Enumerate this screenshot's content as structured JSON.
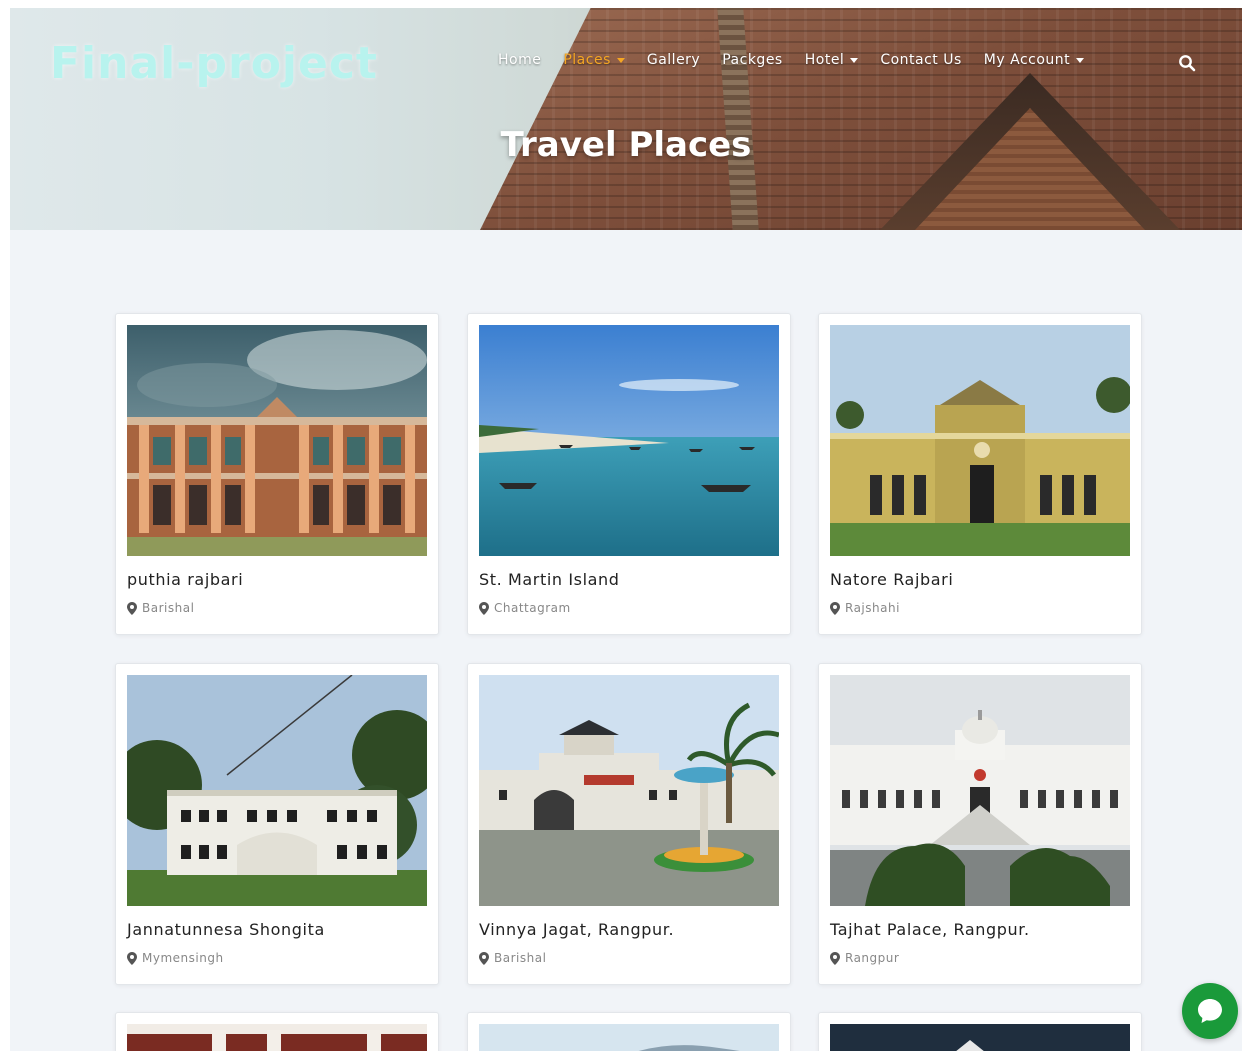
{
  "header": {
    "brand": "Final-project",
    "nav": [
      {
        "label": "Home",
        "active": false,
        "dropdown": false
      },
      {
        "label": "Places",
        "active": true,
        "dropdown": true
      },
      {
        "label": "Gallery",
        "active": false,
        "dropdown": false
      },
      {
        "label": "Packges",
        "active": false,
        "dropdown": false
      },
      {
        "label": "Hotel",
        "active": false,
        "dropdown": true
      },
      {
        "label": "Contact Us",
        "active": false,
        "dropdown": false
      },
      {
        "label": "My Account",
        "active": false,
        "dropdown": true
      }
    ],
    "search_icon": "search-icon",
    "hero_title": "Travel Places"
  },
  "places": [
    {
      "title": "puthia rajbari",
      "location": "Barishal",
      "image": "palace-orange-columns"
    },
    {
      "title": "St. Martin Island",
      "location": "Chattagram",
      "image": "sea-with-boats"
    },
    {
      "title": "Natore Rajbari",
      "location": "Rajshahi",
      "image": "yellow-palace"
    },
    {
      "title": "Jannatunnesa Shongita",
      "location": "Mymensingh",
      "image": "white-building-trees"
    },
    {
      "title": "Vinnya Jagat, Rangpur.",
      "location": "Barishal",
      "image": "park-gate-fountain"
    },
    {
      "title": "Tajhat Palace, Rangpur.",
      "location": "Rangpur",
      "image": "white-palace"
    }
  ],
  "colors": {
    "accent": "#f5a623",
    "chat": "#1a9a3a",
    "brand": "#b8f3ee"
  },
  "chat_icon": "chat-bubble-icon"
}
